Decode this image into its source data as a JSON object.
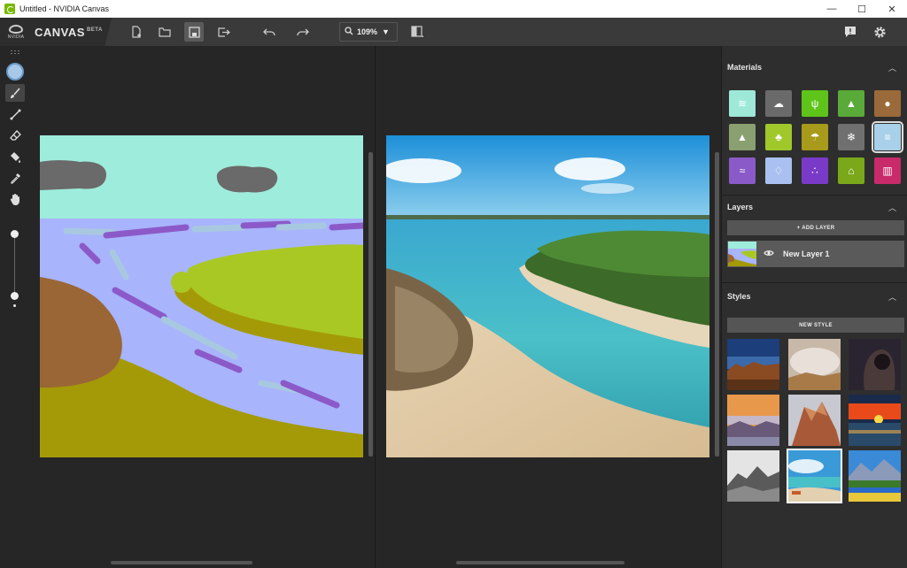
{
  "window": {
    "title": "Untitled - NVIDIA Canvas"
  },
  "brand": {
    "logo_text": "NVIDIA",
    "name": "CANVAS",
    "badge": "BETA"
  },
  "toolbar": {
    "zoom": "109%"
  },
  "panel": {
    "materials": {
      "title": "Materials",
      "items": [
        {
          "icon": "sky-icon",
          "color": "#9ee8d8"
        },
        {
          "icon": "cloud-icon",
          "color": "#6a6a6a"
        },
        {
          "icon": "grass-icon",
          "color": "#5ec419"
        },
        {
          "icon": "hill-icon",
          "color": "#5aaa3a"
        },
        {
          "icon": "dirt-icon",
          "color": "#9a6a3a"
        },
        {
          "icon": "mountain-icon",
          "color": "#8aa070"
        },
        {
          "icon": "tree-icon",
          "color": "#a0c82a"
        },
        {
          "icon": "beach-icon",
          "color": "#a89a1a"
        },
        {
          "icon": "snow-icon",
          "color": "#707070"
        },
        {
          "icon": "water-icon",
          "color": "#a8d0e8"
        },
        {
          "icon": "sea-icon",
          "color": "#8a5ac8"
        },
        {
          "icon": "rain-icon",
          "color": "#aac0f0"
        },
        {
          "icon": "fog-icon",
          "color": "#7a3ac8"
        },
        {
          "icon": "stone-wall-icon",
          "color": "#7aa81a"
        },
        {
          "icon": "building-icon",
          "color": "#c82a6a"
        }
      ]
    },
    "layers": {
      "title": "Layers",
      "add_label": "+ ADD LAYER",
      "items": [
        {
          "name": "New Layer 1"
        }
      ]
    },
    "styles": {
      "title": "Styles",
      "new_label": "NEW STYLE"
    }
  }
}
